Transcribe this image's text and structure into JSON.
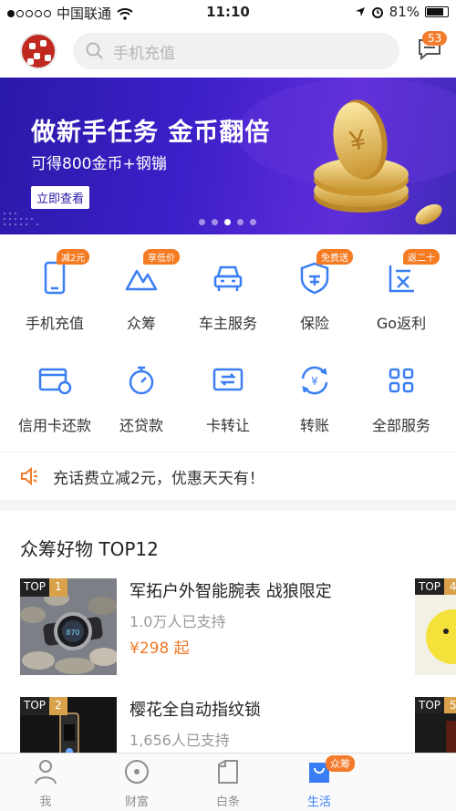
{
  "status_bar": {
    "carrier": "中国联通",
    "time": "11:10",
    "battery": "81%",
    "battery_level": 0.81
  },
  "header": {
    "search_placeholder": "手机充值",
    "message_count": "53"
  },
  "banner": {
    "title": "做新手任务 金币翻倍",
    "subtitle": "可得800金币+钢镚",
    "button": "立即查看",
    "page_count": 5,
    "active_page": 3
  },
  "services": [
    {
      "label": "手机充值",
      "tag": "减2元",
      "icon": "phone-icon"
    },
    {
      "label": "众筹",
      "tag": "享低价",
      "icon": "mountain-icon"
    },
    {
      "label": "车主服务",
      "tag": "",
      "icon": "car-icon"
    },
    {
      "label": "保险",
      "tag": "免费送",
      "icon": "shield-icon"
    },
    {
      "label": "Go返利",
      "tag": "返二十",
      "icon": "rebate-icon"
    },
    {
      "label": "信用卡还款",
      "tag": "",
      "icon": "credit-card-icon"
    },
    {
      "label": "还贷款",
      "tag": "",
      "icon": "stopwatch-icon"
    },
    {
      "label": "卡转让",
      "tag": "",
      "icon": "card-transfer-icon"
    },
    {
      "label": "转账",
      "tag": "",
      "icon": "transfer-icon"
    },
    {
      "label": "全部服务",
      "tag": "",
      "icon": "grid-icon"
    }
  ],
  "notice": {
    "text": "充话费立减2元，优惠天天有！",
    "icon": "speaker-icon"
  },
  "crowdfund": {
    "title": "众筹好物 TOP12",
    "items": [
      {
        "rank_label": "TOP",
        "rank": "1",
        "name": "军拓户外智能腕表 战狼限定",
        "support": "1.0万人已支持",
        "price": "¥298",
        "price_suffix": "起"
      },
      {
        "rank_label": "TOP",
        "rank": "2",
        "name": "樱花全自动指纹锁",
        "support": "1,656人已支持"
      }
    ],
    "side_ranks": [
      "4",
      "5"
    ]
  },
  "tabbar": {
    "tabs": [
      {
        "label": "我",
        "icon": "person-icon"
      },
      {
        "label": "财富",
        "icon": "wealth-icon"
      },
      {
        "label": "白条",
        "icon": "note-icon"
      },
      {
        "label": "生活",
        "icon": "shopping-bag-icon"
      }
    ],
    "badge": "众筹"
  },
  "colors": {
    "accent": "#3a7ef5",
    "orange": "#f37b2b",
    "banner": "#3b1fc8"
  }
}
